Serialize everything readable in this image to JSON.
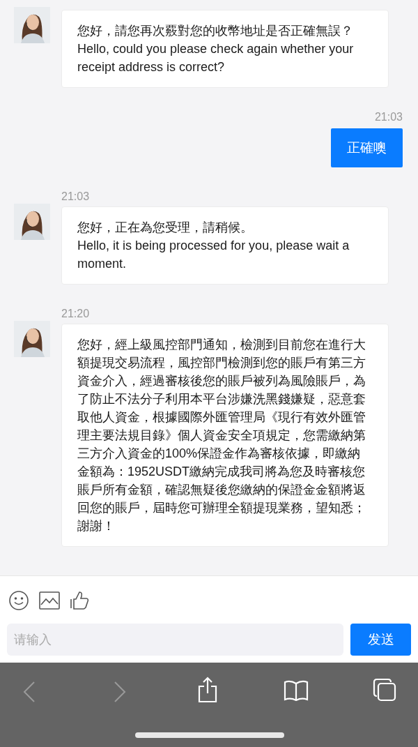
{
  "messages": [
    {
      "kind": "incoming",
      "text": "您好，請您再次覈對您的收幣地址是否正確無誤？\nHello, could you please check again whether your receipt address is correct?"
    },
    {
      "kind": "outgoing",
      "time": "21:03",
      "text": "正確噢"
    },
    {
      "kind": "incoming",
      "time": "21:03",
      "text": "您好，正在為您受理，請稍候。\nHello, it is being processed for you, please wait a moment."
    },
    {
      "kind": "incoming",
      "time": "21:20",
      "text": "您好，經上級風控部門通知，檢測到目前您在進行大額提現交易流程，風控部門檢測到您的賬戶有第三方資金介入，經過審核後您的賬戶被列為風險賬戶，為了防止不法分子利用本平台涉嫌洗黑錢嫌疑，惡意套取他人資金，根據國際外匯管理局《現行有效外匯管理主要法規目錄》個人資金安全項規定，您需繳納第三方介入資金的100%保證金作為審核依據，即繳納金額為：1952USDT繳納完成我司將為您及時審核您賬戶所有金額，確認無疑後您繳納的保證金金額將返回您的賬戶，屆時您可辦理全額提現業務，望知悉；謝謝！"
    }
  ],
  "composer": {
    "placeholder": "请输入",
    "send": "发送"
  }
}
